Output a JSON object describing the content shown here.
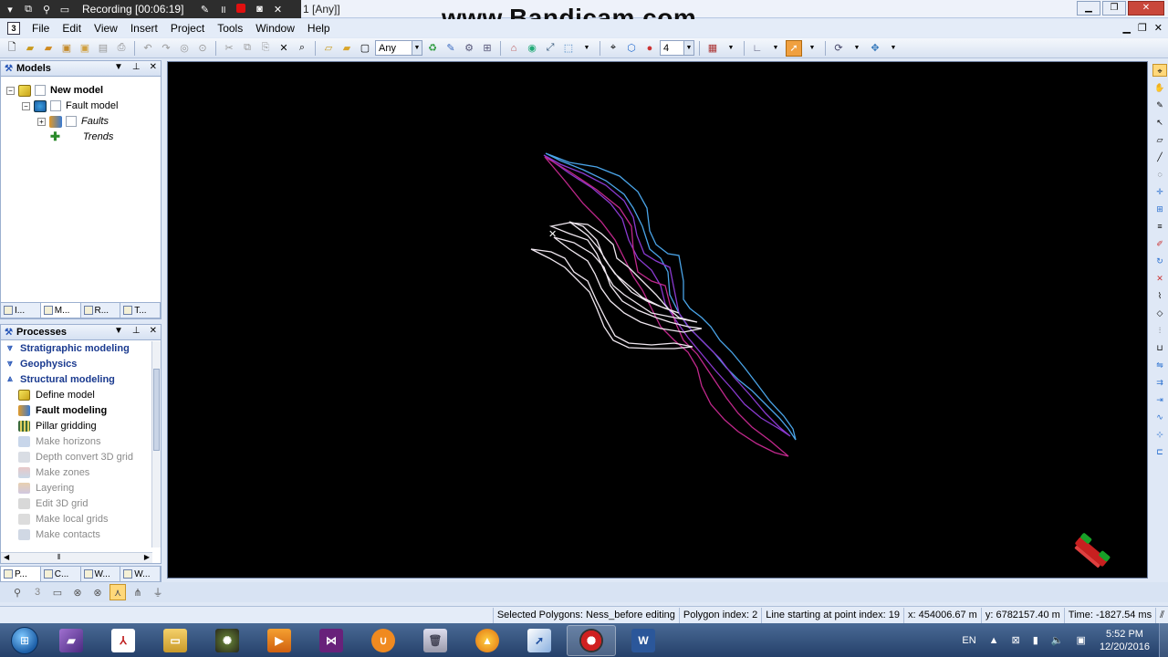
{
  "recording": {
    "label": "Recording [00:06:19]"
  },
  "window": {
    "title_fragment": "1 [Any]]",
    "watermark": "www.Bandicam.com"
  },
  "menu": {
    "app_icon": "3",
    "items": [
      "File",
      "Edit",
      "View",
      "Insert",
      "Project",
      "Tools",
      "Window",
      "Help"
    ]
  },
  "toolbar": {
    "filter_value": "Any",
    "count_value": "4"
  },
  "models_panel": {
    "title": "Models",
    "tree": {
      "root": "New model",
      "child": "Fault model",
      "faults": "Faults",
      "trends": "Trends"
    },
    "tabs": [
      "I...",
      "M...",
      "R...",
      "T..."
    ]
  },
  "processes_panel": {
    "title": "Processes",
    "groups": [
      "Stratigraphic modeling",
      "Geophysics",
      "Structural modeling"
    ],
    "items": [
      {
        "label": "Define model",
        "state": "normal"
      },
      {
        "label": "Fault modeling",
        "state": "bold"
      },
      {
        "label": "Pillar gridding",
        "state": "normal"
      },
      {
        "label": "Make horizons",
        "state": "disabled"
      },
      {
        "label": "Depth convert 3D grid",
        "state": "disabled"
      },
      {
        "label": "Make zones",
        "state": "disabled"
      },
      {
        "label": "Layering",
        "state": "disabled"
      },
      {
        "label": "Edit 3D grid",
        "state": "disabled"
      },
      {
        "label": "Make local grids",
        "state": "disabled"
      },
      {
        "label": "Make contacts",
        "state": "disabled"
      }
    ],
    "tabs": [
      "P...",
      "C...",
      "W...",
      "W..."
    ]
  },
  "viewer_toolbar": {
    "step_value": "3"
  },
  "status_bar": {
    "selected": "Selected Polygons: Ness_before editing",
    "polygon_index": "Polygon index: 2",
    "line_start": "Line starting at point index: 19",
    "x": "x: 454006.67 m",
    "y": "y: 6782157.40 m",
    "time": "Time: -1827.54 ms"
  },
  "taskbar": {
    "apps": [
      "book-app",
      "pdf-reader",
      "file-explorer",
      "photo-app",
      "media-player",
      "visual-studio",
      "uc-browser",
      "recycle-bin",
      "vlc-player",
      "petrel-app",
      "bandicam",
      "word"
    ],
    "language": "EN",
    "time": "5:52 PM",
    "date": "12/20/2016"
  },
  "colors": {
    "viewport_bg": "#000000",
    "fault_magenta": "#c0288c",
    "fault_purple": "#8a3ad0",
    "fault_blue": "#4aa4e8",
    "fault_white": "#f0e8f0",
    "accent": "#1a3a8f"
  }
}
